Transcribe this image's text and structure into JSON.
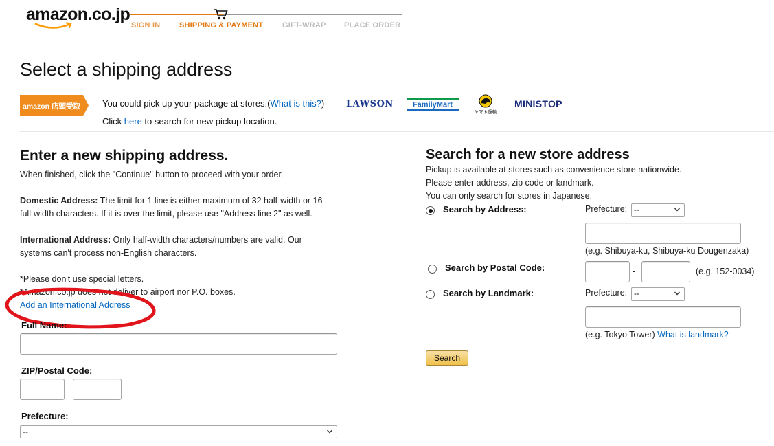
{
  "header": {
    "logo_text": "amazon.co.jp",
    "steps": [
      "SIGN IN",
      "SHIPPING & PAYMENT",
      "GIFT-WRAP",
      "PLACE ORDER"
    ]
  },
  "page": {
    "title": "Select a shipping address"
  },
  "pickup": {
    "banner_text": "amazon 店頭受取",
    "line1_prefix": "You could pick up your package at stores.(",
    "line1_link": "What is this?",
    "line1_suffix": ")",
    "line2_prefix": "Click ",
    "line2_link": "here",
    "line2_suffix": " to search for new pickup location.",
    "stores": [
      "LAWSON",
      "FamilyMart",
      "ヤマト運輸",
      "MINISTOP"
    ]
  },
  "new_address": {
    "heading": "Enter a new shipping address.",
    "intro": "When finished, click the \"Continue\" button to proceed with your order.",
    "domestic_label": "Domestic Address:",
    "domestic_text_1": " The limit for 1 line is either maximum of 32 half-width or 16",
    "domestic_text_2": "full-width characters. If it is over the limit, please use \"Address line 2\" as well.",
    "international_label": "International Address:",
    "international_text_1": " Only half-width characters/numbers are valid. Our",
    "international_text_2": "systems can't process non-English characters.",
    "note1": "*Please don't use special letters.",
    "note2": "*Amazon.co.jp does not deliver to airport nor P.O. boxes.",
    "intl_link": "Add an International Address",
    "full_name_label": "Full Name:",
    "full_name_value": "",
    "zip_label": "ZIP/Postal Code:",
    "zip_sep": "-",
    "prefecture_label": "Prefecture:",
    "prefecture_value": "--"
  },
  "store_search": {
    "heading": "Search for a new store address",
    "desc1": "Pickup is available at stores such as convenience store nationwide.",
    "desc2": "Please enter address, zip code or landmark.",
    "desc3": "You can only search for stores in Japanese.",
    "by_address_label": "Search by Address:",
    "by_address_selected": true,
    "prefecture_label": "Prefecture:",
    "prefecture_value": "--",
    "address_example": "(e.g. Shibuya-ku, Shibuya-ku Dougenzaka)",
    "by_postal_label": "Search by Postal Code:",
    "postal_sep": "-",
    "postal_example": "(e.g. 152-0034)",
    "by_landmark_label": "Search by Landmark:",
    "landmark_prefecture_label": "Prefecture:",
    "landmark_prefecture_value": "--",
    "landmark_example": "(e.g. Tokyo Tower)",
    "landmark_link": "What is landmark?",
    "search_button": "Search"
  },
  "colors": {
    "accent_orange": "#e47911",
    "link_blue": "#0066c0",
    "annotation_red": "#e0141a",
    "button_gold": "#f0c14b"
  }
}
